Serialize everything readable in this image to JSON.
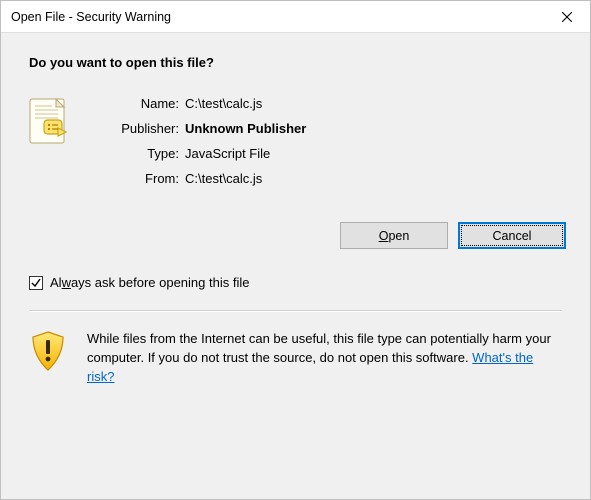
{
  "title": "Open File - Security Warning",
  "question": "Do you want to open this file?",
  "labels": {
    "name": "Name:",
    "publisher": "Publisher:",
    "type": "Type:",
    "from": "From:"
  },
  "values": {
    "name": "C:\\test\\calc.js",
    "publisher": "Unknown Publisher",
    "type": "JavaScript File",
    "from": "C:\\test\\calc.js"
  },
  "buttons": {
    "open_prefix": "",
    "open_ul": "O",
    "open_suffix": "pen",
    "cancel": "Cancel"
  },
  "checkbox": {
    "checked": true,
    "prefix": "Al",
    "ul": "w",
    "suffix": "ays ask before opening this file"
  },
  "warning": {
    "text": "While files from the Internet can be useful, this file type can potentially harm your computer. If you do not trust the source, do not open this software. ",
    "link": "What's the risk?"
  }
}
